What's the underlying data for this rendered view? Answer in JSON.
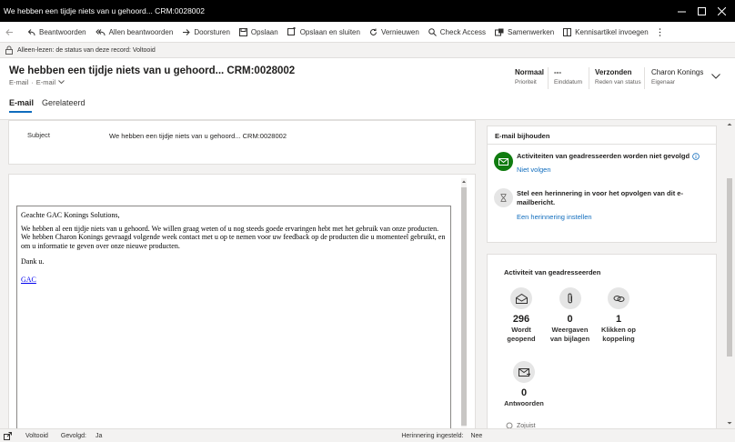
{
  "window": {
    "title": "We hebben een tijdje niets van u gehoord... CRM:0028002"
  },
  "commands": {
    "reply": "Beantwoorden",
    "reply_all": "Allen beantwoorden",
    "forward": "Doorsturen",
    "save": "Opslaan",
    "save_close": "Opslaan en sluiten",
    "refresh": "Vernieuwen",
    "check_access": "Check Access",
    "collaborate": "Samenwerken",
    "kb_article": "Kennisartikel invoegen"
  },
  "readonly_notice": "Alleen-lezen: de status van deze record: Voltooid",
  "record": {
    "title": "We hebben een tijdje niets van u gehoord... CRM:0028002",
    "entity": "E-mail",
    "form": "E-mail"
  },
  "header_fields": [
    {
      "value": "Normaal",
      "label": "Prioriteit"
    },
    {
      "value": "---",
      "label": "Einddatum"
    },
    {
      "value": "Verzonden",
      "label": "Reden van status"
    },
    {
      "value": "Charon Konings",
      "label": "Eigenaar"
    }
  ],
  "tabs": {
    "email": "E-mail",
    "related": "Gerelateerd"
  },
  "subject": {
    "label": "Subject",
    "value": "We hebben een tijdje niets van u gehoord... CRM:0028002"
  },
  "email_body": {
    "greeting": "Geachte GAC Konings Solutions,",
    "paragraph": "We hebben al een tijdje niets van u gehoord. We willen graag weten of u nog steeds goede ervaringen hebt met het gebruik van onze producten. We hebben Charon Konings gevraagd volgende week contact met u op te nemen voor uw feedback op de producten die u momenteel gebruikt, en om u informatie te geven over onze nieuwe producten.",
    "thanks": "Dank u.",
    "signature": "GAC"
  },
  "tracking": {
    "title": "E-mail bijhouden",
    "item1_text": "Activiteiten van geadresseerden worden niet gevolgd",
    "item1_link": "Niet volgen",
    "item2_text": "Stel een herinnering in voor het opvolgen van dit e-mailbericht.",
    "item2_link": "Een herinnering instellen"
  },
  "recipient_activity": {
    "title": "Activiteit van geadresseerden",
    "stats": [
      {
        "value": "296",
        "label": "Wordt geopend",
        "icon": "envelope-open-icon"
      },
      {
        "value": "0",
        "label": "Weergaven van bijlagen",
        "icon": "paperclip-icon"
      },
      {
        "value": "1",
        "label": "Klikken op koppeling",
        "icon": "link-icon"
      },
      {
        "value": "0",
        "label": "Antwoorden",
        "icon": "reply-mail-icon"
      }
    ],
    "partial_next": "Zojuist"
  },
  "statusbar": {
    "state": "Voltooid",
    "followed_label": "Gevolgd:",
    "followed_value": "Ja",
    "reminder_label": "Herinnering ingesteld:",
    "reminder_value": "Nee"
  },
  "colors": {
    "accent": "#0f6cbd",
    "tracking_green": "#107c10"
  }
}
